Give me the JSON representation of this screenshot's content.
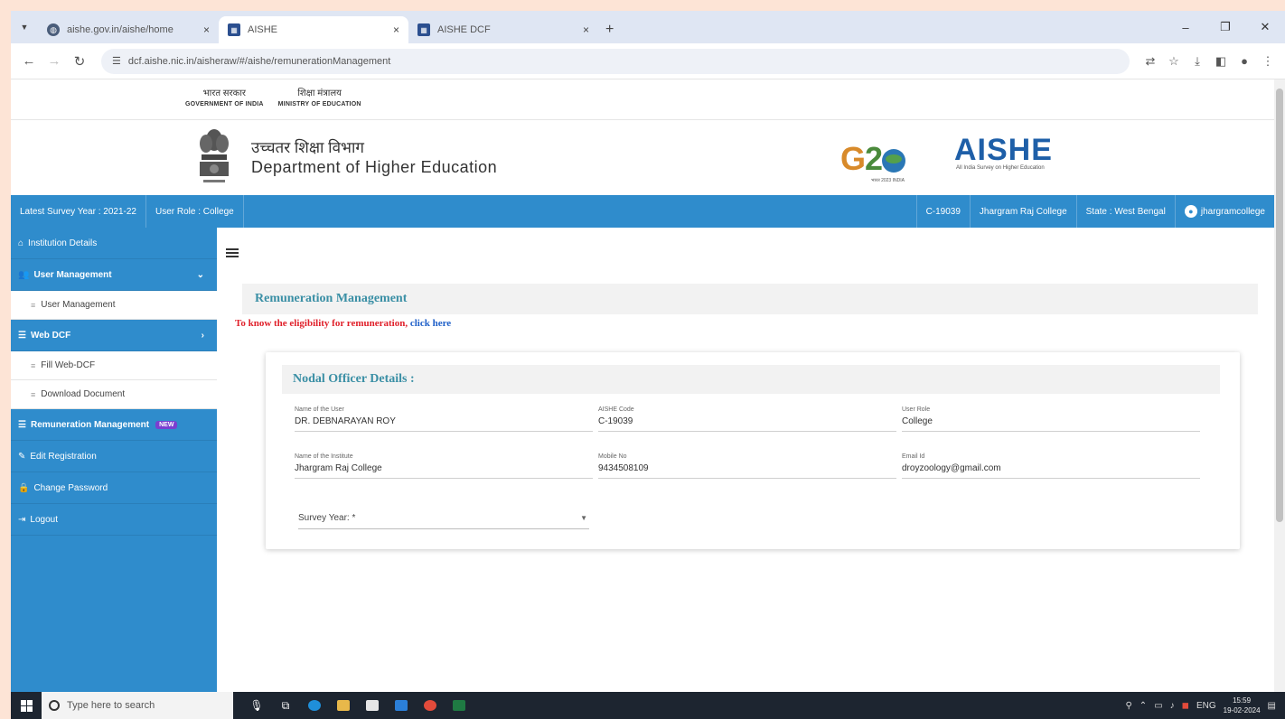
{
  "browser": {
    "tabs": [
      {
        "title": "aishe.gov.in/aishe/home",
        "icon": "globe-icon",
        "close": "×"
      },
      {
        "title": "AISHE",
        "icon": "aishe-favicon-icon",
        "close": "×"
      },
      {
        "title": "AISHE DCF",
        "icon": "aishe-favicon-icon",
        "close": "×"
      }
    ],
    "new_tab": "+",
    "url": "dcf.aishe.nic.in/aisheraw/#/aishe/remunerationManagement",
    "window_controls": {
      "minimize": "–",
      "maximize": "❐",
      "close": "✕"
    }
  },
  "gov_strip": {
    "left_hi": "भारत सरकार",
    "left_en": "GOVERNMENT OF INDIA",
    "right_hi": "शिक्षा मंत्रालय",
    "right_en": "MINISTRY OF EDUCATION"
  },
  "brand": {
    "dept_hi": "उच्चतर शिक्षा विभाग",
    "dept_en": "Department of Higher Education",
    "g20_text": "G20",
    "aishe": "AISHE",
    "aishe_tag": "All India Survey on Higher Education"
  },
  "infobar": {
    "survey_year": "Latest Survey Year : 2021-22",
    "user_role": "User Role : College",
    "code": "C-19039",
    "college": "Jhargram Raj College",
    "state": "State : West Bengal",
    "username": "jhargramcollege"
  },
  "sidebar": {
    "items": [
      {
        "label": "Institution Details",
        "icon": "home-icon"
      },
      {
        "label": "User Management",
        "icon": "users-icon",
        "chevron": "⌄"
      },
      {
        "sub": "User Management"
      },
      {
        "label": "Web DCF",
        "icon": "list-icon",
        "chevron": "›"
      },
      {
        "sub": "Fill Web-DCF"
      },
      {
        "sub": "Download Document"
      },
      {
        "label": "Remuneration Management",
        "icon": "list-icon",
        "badge": "NEW"
      },
      {
        "label": "Edit Registration",
        "icon": "edit-icon"
      },
      {
        "label": "Change Password",
        "icon": "lock-icon"
      },
      {
        "label": "Logout",
        "icon": "logout-icon"
      }
    ]
  },
  "main": {
    "heading": "Remuneration Management",
    "eligibility_text": "To know the eligibility for remuneration,",
    "eligibility_link": "click here",
    "card": {
      "title": "Nodal Officer Details :",
      "fields": [
        {
          "label": "Name of the User",
          "value": "DR. DEBNARAYAN ROY"
        },
        {
          "label": "AISHE Code",
          "value": "C-19039"
        },
        {
          "label": "User Role",
          "value": "College"
        },
        {
          "label": "Name of the Institute",
          "value": "Jhargram Raj College"
        },
        {
          "label": "Mobile No",
          "value": "9434508109"
        },
        {
          "label": "Email Id",
          "value": "droyzoology@gmail.com"
        }
      ],
      "survey_label": "Survey Year: *"
    }
  },
  "taskbar": {
    "search_placeholder": "Type here to search",
    "lang": "ENG",
    "time": "15:59",
    "date": "19-02-2024"
  }
}
